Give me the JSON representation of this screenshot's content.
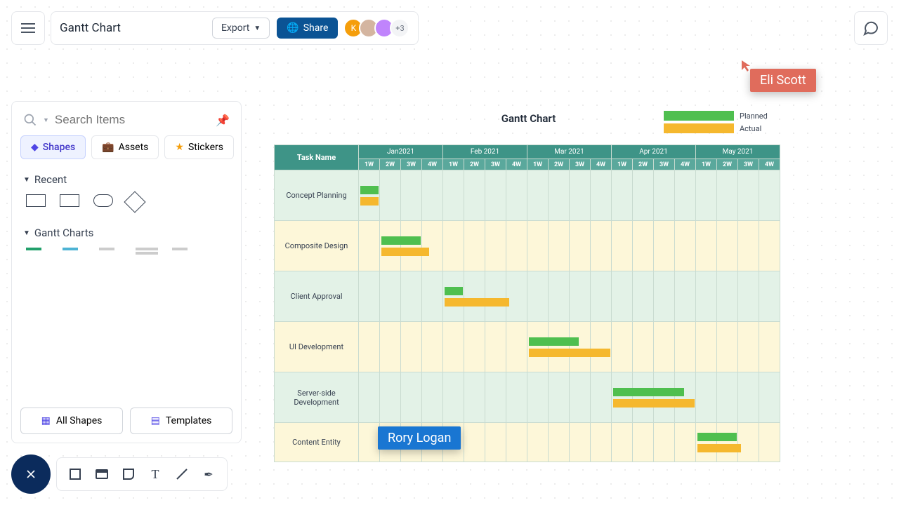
{
  "header": {
    "title": "Gantt Chart",
    "export_label": "Export",
    "share_label": "Share",
    "avatar_k": "K",
    "avatar_plus": "+3"
  },
  "sidebar": {
    "search_placeholder": "Search Items",
    "tabs": {
      "shapes": "Shapes",
      "assets": "Assets",
      "stickers": "Stickers"
    },
    "sections": {
      "recent": "Recent",
      "gantt": "Gantt Charts"
    },
    "all_shapes": "All Shapes",
    "templates": "Templates"
  },
  "legend": {
    "planned": "Planned",
    "actual": "Actual"
  },
  "chart_data": {
    "type": "gantt",
    "title": "Gantt Chart",
    "months": [
      "Jan2021",
      "Feb 2021",
      "Mar 2021",
      "Apr 2021",
      "May 2021"
    ],
    "weeks": [
      "1W",
      "2W",
      "3W",
      "4W"
    ],
    "tasks": [
      {
        "name": "Concept Planning",
        "planned": [
          0,
          1
        ],
        "actual": [
          0,
          1
        ]
      },
      {
        "name": "Composite Design",
        "planned": [
          1,
          2
        ],
        "actual": [
          1,
          2.4
        ]
      },
      {
        "name": "Client Approval",
        "planned": [
          4,
          1
        ],
        "actual": [
          4,
          3.2
        ]
      },
      {
        "name": "UI Development",
        "planned": [
          8,
          2.5
        ],
        "actual": [
          8,
          4
        ]
      },
      {
        "name": "Server-side Development",
        "planned": [
          12,
          3.5
        ],
        "actual": [
          12,
          4
        ]
      },
      {
        "name": "Content Entity",
        "planned": [
          16,
          2
        ],
        "actual": [
          16,
          2.2
        ]
      }
    ]
  },
  "cursors": {
    "blue_name": "Rory Logan",
    "red_name": "Eli Scott"
  }
}
